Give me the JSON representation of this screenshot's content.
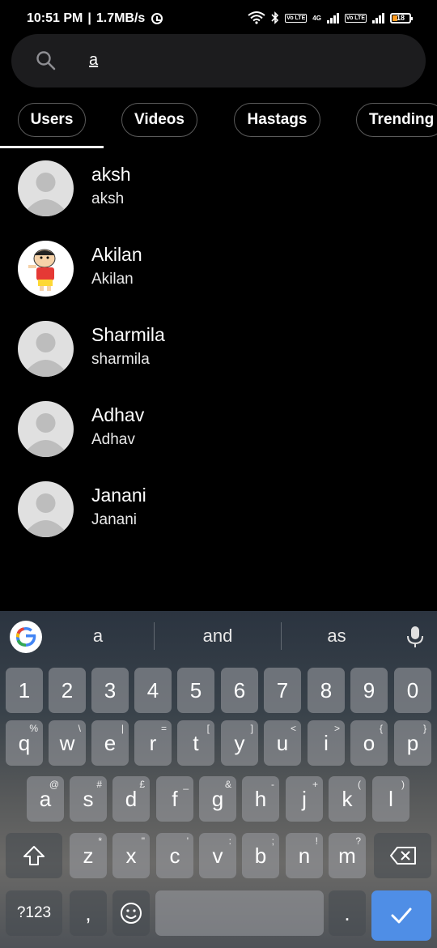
{
  "status": {
    "time": "10:51 PM",
    "speed": "1.7MB/s",
    "net_label": "4G",
    "volte_1": "Vo LTE",
    "volte_2": "Vo LTE",
    "battery": "18"
  },
  "search": {
    "query": "a"
  },
  "tabs": [
    {
      "label": "Users"
    },
    {
      "label": "Videos"
    },
    {
      "label": "Hastags"
    },
    {
      "label": "Trending"
    }
  ],
  "users": [
    {
      "name": "aksh",
      "handle": "aksh"
    },
    {
      "name": "Akilan",
      "handle": "Akilan"
    },
    {
      "name": "Sharmila",
      "handle": "sharmila"
    },
    {
      "name": "Adhav",
      "handle": "Adhav"
    },
    {
      "name": "Janani",
      "handle": "Janani"
    }
  ],
  "keyboard": {
    "suggestions": [
      "a",
      "and",
      "as"
    ],
    "row_numbers": [
      "1",
      "2",
      "3",
      "4",
      "5",
      "6",
      "7",
      "8",
      "9",
      "0"
    ],
    "row1": [
      {
        "k": "q",
        "h": "%"
      },
      {
        "k": "w",
        "h": "\\"
      },
      {
        "k": "e",
        "h": "|"
      },
      {
        "k": "r",
        "h": "="
      },
      {
        "k": "t",
        "h": "["
      },
      {
        "k": "y",
        "h": "]"
      },
      {
        "k": "u",
        "h": "<"
      },
      {
        "k": "i",
        "h": ">"
      },
      {
        "k": "o",
        "h": "{"
      },
      {
        "k": "p",
        "h": "}"
      }
    ],
    "row2": [
      {
        "k": "a",
        "h": "@"
      },
      {
        "k": "s",
        "h": "#"
      },
      {
        "k": "d",
        "h": "£"
      },
      {
        "k": "f",
        "h": "_"
      },
      {
        "k": "g",
        "h": "&"
      },
      {
        "k": "h",
        "h": "-"
      },
      {
        "k": "j",
        "h": "+"
      },
      {
        "k": "k",
        "h": "("
      },
      {
        "k": "l",
        "h": ")"
      }
    ],
    "row3": [
      {
        "k": "z",
        "h": "*"
      },
      {
        "k": "x",
        "h": "\""
      },
      {
        "k": "c",
        "h": "'"
      },
      {
        "k": "v",
        "h": ":"
      },
      {
        "k": "b",
        "h": ";"
      },
      {
        "k": "n",
        "h": "!"
      },
      {
        "k": "m",
        "h": "?"
      }
    ],
    "symbols_label": "?123",
    "comma": ",",
    "period": "."
  }
}
